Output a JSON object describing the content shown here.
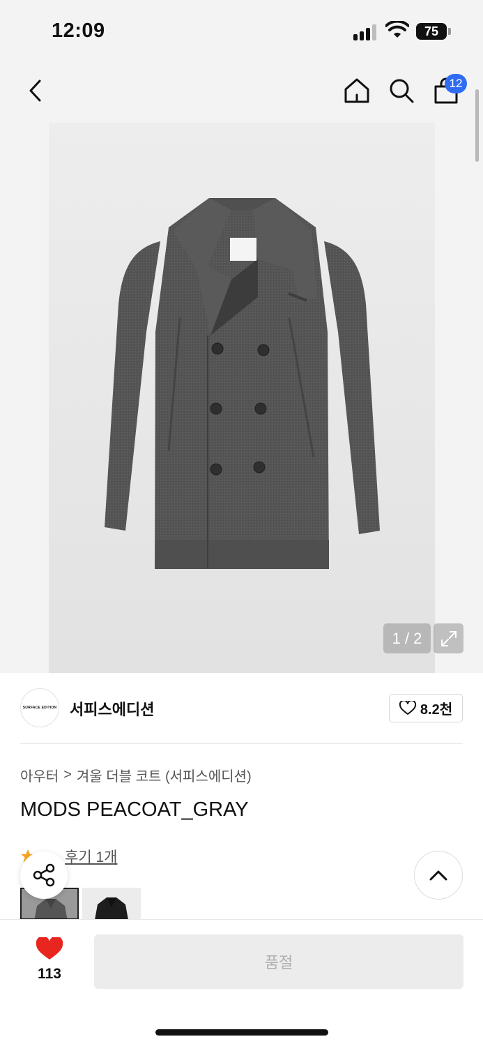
{
  "status_bar": {
    "time": "12:09",
    "battery": "75"
  },
  "header": {
    "cart_count": "12"
  },
  "gallery": {
    "counter": "1 / 2"
  },
  "brand": {
    "logo_text": "SURFACE EDITION",
    "name": "서피스에디션",
    "likes": "8.2천"
  },
  "breadcrumb": {
    "category": "아우터",
    "separator": ">",
    "subcategory": "겨울 더블 코트 (서피스에디션)"
  },
  "product": {
    "title": "MODS PEACOAT_GRAY",
    "reviews": "후기 1개"
  },
  "bottom_bar": {
    "likes": "113",
    "cta_label": "품절"
  },
  "colors": {
    "accent_blue": "#2f6cf2",
    "heart_red": "#e8251f",
    "star_orange": "#f5a623"
  }
}
